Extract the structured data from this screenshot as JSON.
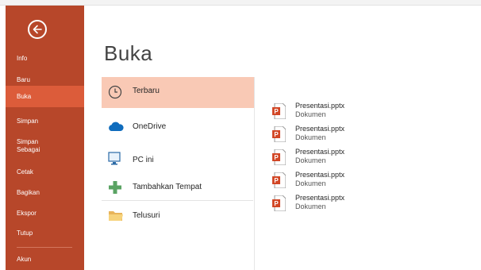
{
  "page": {
    "title": "Buka"
  },
  "sidebar": {
    "items": [
      {
        "label": "Info"
      },
      {
        "label": "Baru"
      },
      {
        "label": "Buka"
      },
      {
        "label": "Simpan"
      },
      {
        "label": "Simpan Sebagai"
      },
      {
        "label": "Cetak"
      },
      {
        "label": "Bagikan"
      },
      {
        "label": "Ekspor"
      },
      {
        "label": "Tutup"
      },
      {
        "label": "Akun"
      }
    ]
  },
  "locations": [
    {
      "label": "Terbaru",
      "icon": "clock-icon"
    },
    {
      "label": "OneDrive",
      "icon": "cloud-icon"
    },
    {
      "label": "PC ini",
      "icon": "computer-icon"
    },
    {
      "label": "Tambahkan Tempat",
      "icon": "plus-icon"
    },
    {
      "label": "Telusuri",
      "icon": "folder-icon"
    }
  ],
  "recent_files": [
    {
      "name": "Presentasi.pptx",
      "location": "Dokumen"
    },
    {
      "name": "Presentasi.pptx",
      "location": "Dokumen"
    },
    {
      "name": "Presentasi.pptx",
      "location": "Dokumen"
    },
    {
      "name": "Presentasi.pptx",
      "location": "Dokumen"
    },
    {
      "name": "Presentasi.pptx",
      "location": "Dokumen"
    }
  ],
  "colors": {
    "sidebar": "#b7472a",
    "selected_nav": "#dc5c3a",
    "selected_location": "#f9c9b5",
    "accent": "#d24726"
  }
}
